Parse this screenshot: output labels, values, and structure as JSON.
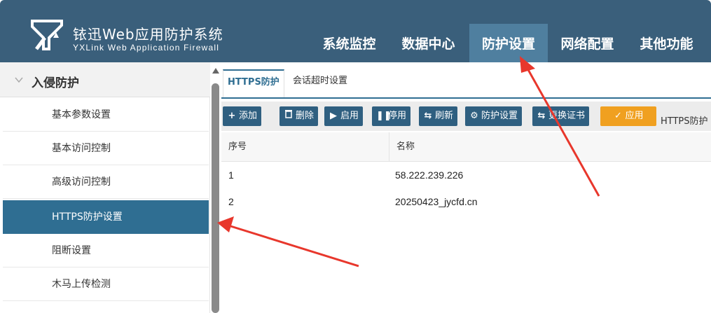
{
  "header": {
    "brand_cn": "铱迅Web应用防护系统",
    "brand_en": "YXLink Web Application Firewall",
    "nav": [
      {
        "label": "系统监控",
        "active": false
      },
      {
        "label": "数据中心",
        "active": false
      },
      {
        "label": "防护设置",
        "active": true
      },
      {
        "label": "网络配置",
        "active": false
      },
      {
        "label": "其他功能",
        "active": false
      }
    ]
  },
  "sidebar": {
    "group_label": "入侵防护",
    "items": [
      {
        "label": "基本参数设置",
        "active": false
      },
      {
        "label": "基本访问控制",
        "active": false
      },
      {
        "label": "高级访问控制",
        "active": false
      },
      {
        "label": "HTTPS防护设置",
        "active": true
      },
      {
        "label": "阻断设置",
        "active": false
      },
      {
        "label": "木马上传检测",
        "active": false
      }
    ]
  },
  "tabs": [
    {
      "label": "HTTPS防护",
      "active": true
    },
    {
      "label": "会话超时设置",
      "active": false
    }
  ],
  "toolbar": {
    "buttons": [
      {
        "label": "添加",
        "icon": "plus-icon"
      },
      {
        "label": "删除",
        "icon": "trash-icon"
      },
      {
        "label": "启用",
        "icon": "play-icon"
      },
      {
        "label": "停用",
        "icon": "pause-icon"
      },
      {
        "label": "刷新",
        "icon": "refresh-icon"
      },
      {
        "label": "防护设置",
        "icon": "gear-icon"
      },
      {
        "label": "更换证书",
        "icon": "exchange-icon"
      },
      {
        "label": "应用",
        "icon": "check-icon"
      }
    ],
    "trailing_label": "HTTPS防护"
  },
  "table": {
    "columns": [
      "序号",
      "名称"
    ],
    "rows": [
      [
        "1",
        "58.222.239.226"
      ],
      [
        "2",
        "20250423_jycfd.cn"
      ]
    ]
  },
  "colors": {
    "header_bg": "#3a5f7b",
    "nav_active": "#4f7f9f",
    "sidebar_active": "#2f6e92",
    "toolbar_button": "#2f5f80",
    "apply_button": "#f0a020",
    "annotation_arrow": "#e8372c"
  }
}
